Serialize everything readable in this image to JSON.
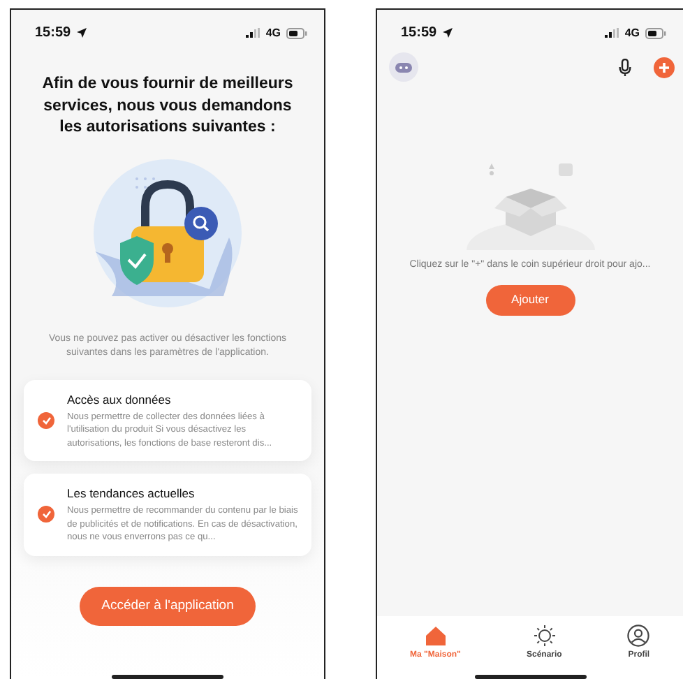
{
  "permission_screen": {
    "status_bar": {
      "time": "15:59",
      "network": "4G"
    },
    "title": "Afin de vous fournir de meilleurs services, nous vous demandons les autorisations suivantes :",
    "note": "Vous ne pouvez pas activer ou désactiver les fonctions suivantes dans les paramètres de l'application.",
    "permissions": [
      {
        "title": "Accès aux données",
        "description": "Nous permettre de collecter des données liées à l'utilisation du produit Si vous désactivez les autorisations, les fonctions de base resteront dis...",
        "checked": true
      },
      {
        "title": "Les tendances actuelles",
        "description": "Nous permettre de recommander du contenu par le biais de publicités et de notifications. En cas de désactivation, nous ne vous enverrons pas ce qu...",
        "checked": true
      }
    ],
    "button": "Accéder à l'application"
  },
  "home_screen": {
    "status_bar": {
      "time": "15:59",
      "network": "4G"
    },
    "empty_message": "Cliquez sur le \"+\" dans le coin supérieur droit pour ajo...",
    "add_button": "Ajouter",
    "tabs": [
      {
        "kind": "home",
        "label": "Ma \"Maison\"",
        "selected": true
      },
      {
        "kind": "scene",
        "label": "Scénario",
        "selected": false
      },
      {
        "kind": "profile",
        "label": "Profil",
        "selected": false
      }
    ]
  }
}
